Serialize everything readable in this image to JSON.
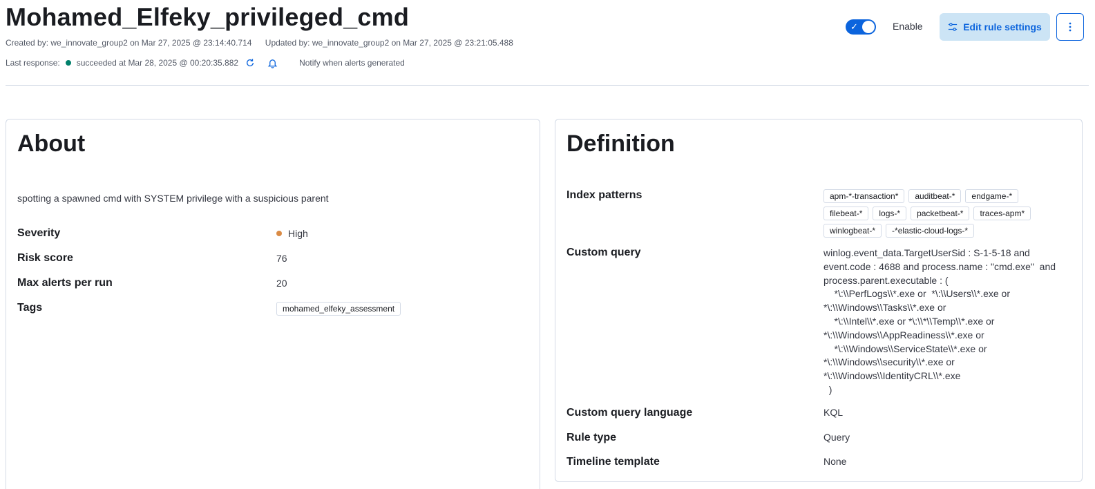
{
  "header": {
    "title": "Mohamed_Elfeky_privileged_cmd",
    "created_by": "Created by: we_innovate_group2 on Mar 27, 2025 @ 23:14:40.714",
    "updated_by": "Updated by: we_innovate_group2 on Mar 27, 2025 @ 23:21:05.488",
    "last_response_label": "Last response:",
    "last_response_status": "succeeded at Mar 28, 2025 @ 00:20:35.882",
    "notify_text": "Notify when alerts generated",
    "enable_label": "Enable",
    "enabled": true,
    "edit_button_label": "Edit rule settings",
    "icons": [
      "refresh-icon",
      "bell-icon",
      "sliders-icon",
      "more-vertical-icon",
      "check-icon"
    ]
  },
  "colors": {
    "accent": "#0b64dd",
    "success": "#00806b",
    "severity_high": "#da8b45",
    "toggle_on": "#0b64dd"
  },
  "about": {
    "title": "About",
    "description": "spotting a spawned cmd with SYSTEM privilege with a suspicious parent",
    "severity_label": "Severity",
    "severity_value": "High",
    "risk_label": "Risk score",
    "risk_value": "76",
    "max_alerts_label": "Max alerts per run",
    "max_alerts_value": "20",
    "tags_label": "Tags",
    "tags": [
      "mohamed_elfeky_assessment"
    ]
  },
  "definition": {
    "title": "Definition",
    "index_label": "Index patterns",
    "index_patterns": [
      "apm-*-transaction*",
      "auditbeat-*",
      "endgame-*",
      "filebeat-*",
      "logs-*",
      "packetbeat-*",
      "traces-apm*",
      "winlogbeat-*",
      "-*elastic-cloud-logs-*"
    ],
    "query_label": "Custom query",
    "query": "winlog.event_data.TargetUserSid : S-1-5-18 and\nevent.code : 4688 and process.name : \"cmd.exe\"  and\nprocess.parent.executable : (\n    *\\:\\\\PerfLogs\\\\*.exe or  *\\:\\\\Users\\\\*.exe or\n*\\:\\\\Windows\\\\Tasks\\\\*.exe or\n    *\\:\\\\Intel\\\\*.exe or *\\:\\\\*\\\\Temp\\\\*.exe or\n*\\:\\\\Windows\\\\AppReadiness\\\\*.exe or\n    *\\:\\\\Windows\\\\ServiceState\\\\*.exe or\n*\\:\\\\Windows\\\\security\\\\*.exe or\n*\\:\\\\Windows\\\\IdentityCRL\\\\*.exe\n  )",
    "query_language_label": "Custom query language",
    "query_language_value": "KQL",
    "rule_type_label": "Rule type",
    "rule_type_value": "Query",
    "timeline_label": "Timeline template",
    "timeline_value": "None"
  }
}
